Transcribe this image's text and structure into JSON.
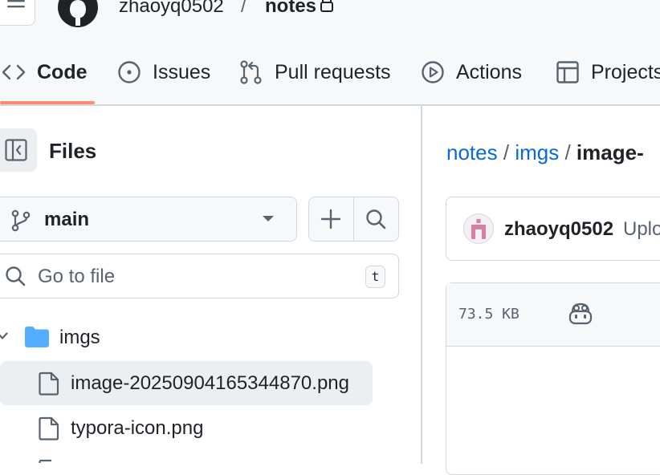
{
  "repo": {
    "owner": "zhaoyq0502",
    "separator": "/",
    "name": "notes"
  },
  "tabs": [
    {
      "label": "Code",
      "icon": "code-icon",
      "selected": true
    },
    {
      "label": "Issues",
      "icon": "issue-opened-icon"
    },
    {
      "label": "Pull requests",
      "icon": "git-pull-request-icon"
    },
    {
      "label": "Actions",
      "icon": "play-icon"
    },
    {
      "label": "Projects",
      "icon": "table-icon"
    }
  ],
  "sidebar": {
    "title": "Files",
    "branch": "main",
    "search_placeholder": "Go to file",
    "search_shortcut": "t",
    "tree": {
      "folder": "imgs",
      "files": [
        "image-20250904165344870.png",
        "typora-icon.png"
      ]
    }
  },
  "main": {
    "breadcrumb": [
      "notes",
      "imgs",
      "image-"
    ],
    "breadcrumb_sep": "/",
    "commit": {
      "author": "zhaoyq0502",
      "message": "Uplo"
    },
    "file_size": "73.5 KB"
  },
  "colors": {
    "accent": "#0969da",
    "tab_underline": "#fd8c73",
    "folder": "#54aeff"
  }
}
